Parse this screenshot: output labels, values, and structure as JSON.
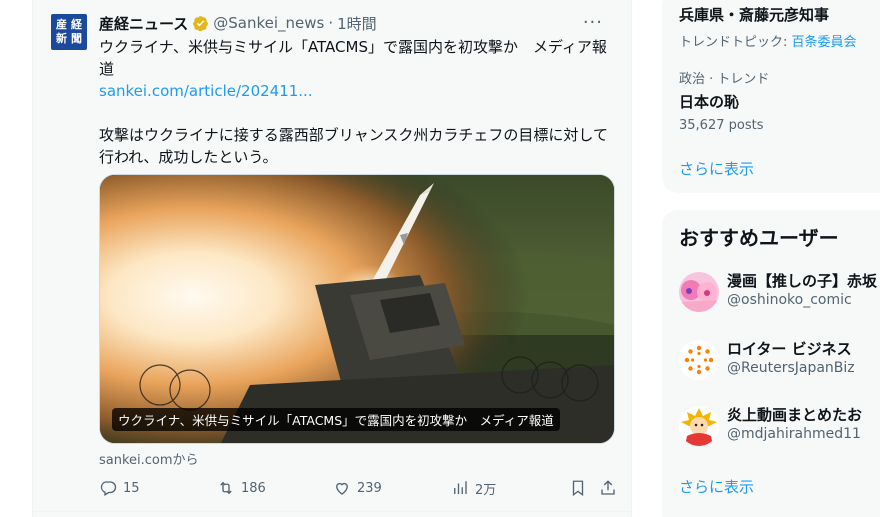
{
  "tweet": {
    "avatar_chars": [
      "産",
      "経",
      "新",
      "聞"
    ],
    "name": "産経ニュース",
    "handle": "@Sankei_news",
    "dot": "·",
    "time": "1時間",
    "more": "···",
    "title_line_1": "ウクライナ、米供与ミサイル「ATACMS」で露国内を初攻撃か　メディア報",
    "title_line_2": "道",
    "link": "sankei.com/article/202411...",
    "body_line_1": "攻撃はウクライナに接する露西部ブリャンスク州カラチェフの目標に対して",
    "body_line_2": "行われ、成功したという。",
    "card_caption": "ウクライナ、米供与ミサイル「ATACMS」で露国内を初攻撃か　メディア報道",
    "card_source": "sankei.comから",
    "replies": "15",
    "retweets": "186",
    "likes": "239",
    "views": "2万"
  },
  "trends": [
    {
      "title": "兵庫県・斎藤元彦知事",
      "sub_prefix": "トレンドトピック: ",
      "sub_link": "百条委員会"
    },
    {
      "category": "政治 · トレンド",
      "title": "日本の恥",
      "posts": "35,627 posts"
    }
  ],
  "show_more": "さらに表示",
  "who_to_follow": {
    "title": "おすすめユーザー",
    "users": [
      {
        "name": "漫画【推しの子】赤坂",
        "handle": "@oshinoko_comic",
        "icon": "anime-avatar"
      },
      {
        "name": "ロイター ビジネス",
        "handle": "@ReutersJapanBiz",
        "icon": "reuters-logo"
      },
      {
        "name": "炎上動画まとめたお",
        "handle": "@mdjahirahmed11",
        "icon": "cartoon-avatar"
      }
    ]
  },
  "colors": {
    "accent": "#1d9bf0",
    "secondary_text": "#536471",
    "verified_gold": "#e2b719",
    "avatar_blue": "#1b4a9c"
  }
}
